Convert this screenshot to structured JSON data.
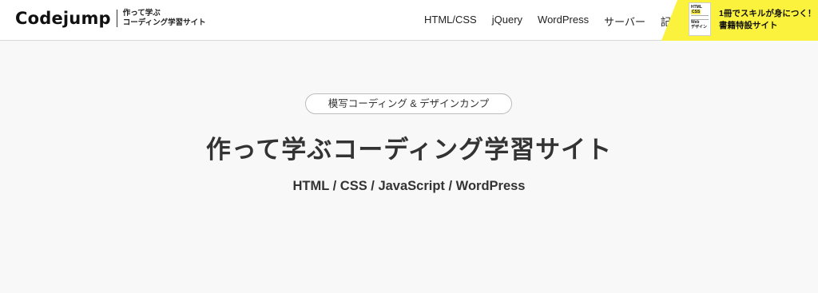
{
  "header": {
    "logo": "Codejump",
    "tagline_line1": "作って学ぶ",
    "tagline_line2": "コーディング学習サイト",
    "nav": [
      "HTML/CSS",
      "jQuery",
      "WordPress",
      "サーバー",
      "記事"
    ]
  },
  "banner": {
    "line1": "1冊でスキルが身につく！",
    "line2": "書籍特設サイト",
    "book_cover": {
      "line1": "HTML",
      "line2": "CSS",
      "line3": "Web",
      "line4": "デザイン"
    }
  },
  "hero": {
    "pill": "模写コーディング & デザインカンプ",
    "title": "作って学ぶコーディング学習サイト",
    "subtitle": "HTML / CSS / JavaScript / WordPress"
  },
  "colors": {
    "banner_bg": "#fbf23d",
    "page_bg": "#f8f8f8",
    "text": "#333333"
  }
}
